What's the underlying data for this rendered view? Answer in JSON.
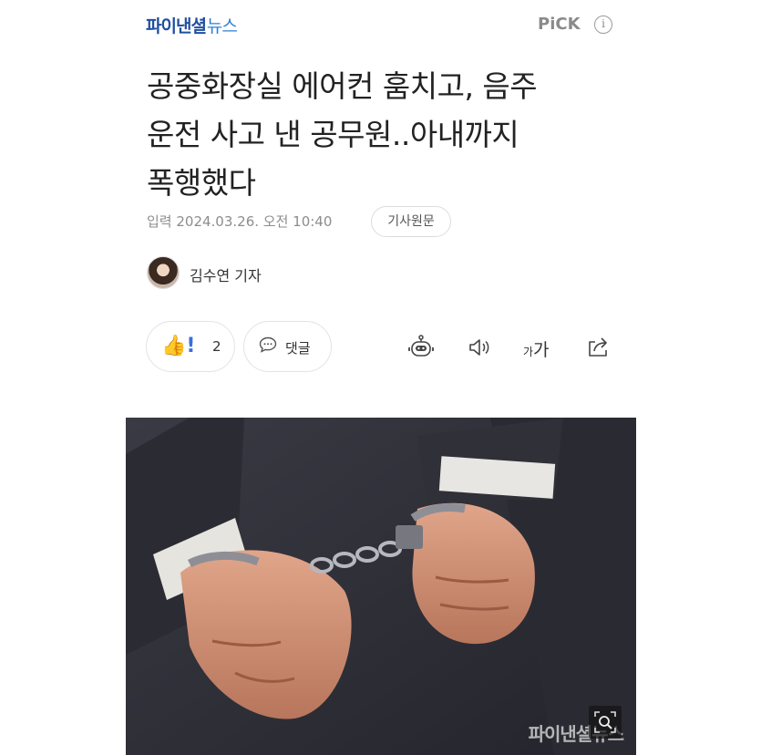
{
  "header": {
    "brand_main": "파이낸셜",
    "brand_sub": "뉴스",
    "pick_label": "PiCK",
    "info_glyph": "i"
  },
  "article": {
    "headline_lines": [
      "공중화장실 에어컨 훔치고, 음주",
      "운전 사고 낸 공무원..아내까지",
      "폭행했다"
    ],
    "meta": "입력 2024.03.26. 오전 10:40",
    "original_button": "기사원문",
    "reporter": "김수연 기자"
  },
  "actions": {
    "reaction_count": "2",
    "comment_label": "댓글",
    "font_small": "가",
    "font_large": "가"
  },
  "icons": {
    "reaction": "clap-thumbs-exclaim-icon",
    "comment": "speech-bubble-icon",
    "summary": "robot-icon",
    "audio": "speaker-icon",
    "font": "font-size-icon",
    "share": "share-icon",
    "zoom": "magnifier-icon"
  },
  "photo": {
    "watermark": "파이낸셜뉴스"
  },
  "colors": {
    "brand": "#1f4fa0",
    "brand_sub": "#2d7fd6",
    "meta_text": "#8d8d8d"
  }
}
